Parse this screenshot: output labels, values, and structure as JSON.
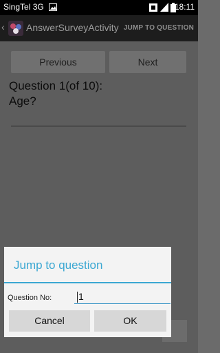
{
  "status_bar": {
    "carrier": "SingTel 3G",
    "time": "18:11",
    "icons": [
      "image-icon",
      "sim-icon",
      "signal-icon",
      "battery-icon"
    ]
  },
  "action_bar": {
    "title": "AnswerSurveyActivity",
    "jump_action": "JUMP TO QUESTION",
    "icons": [
      "up-caret-icon",
      "app-icon"
    ]
  },
  "survey": {
    "previous_label": "Previous",
    "next_label": "Next",
    "question_header": "Question 1(of 10):",
    "question_text": "Age?"
  },
  "dialog": {
    "title": "Jump to question",
    "field_label": "Question No:",
    "field_value": "1",
    "cancel_label": "Cancel",
    "ok_label": "OK",
    "accent_color": "#3aa7d2"
  }
}
